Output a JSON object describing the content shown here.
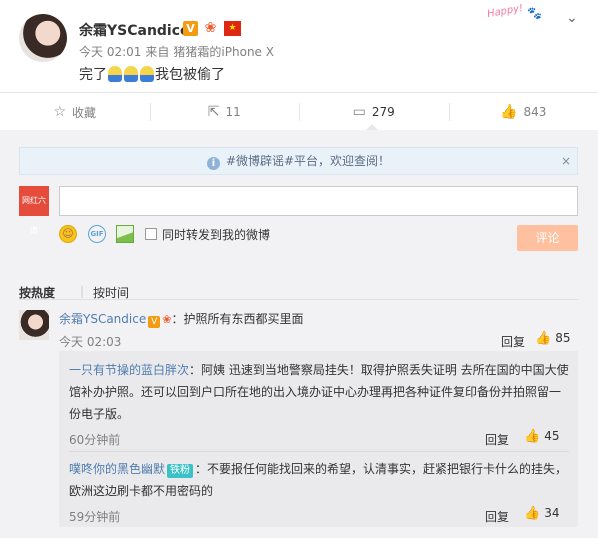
{
  "post": {
    "author": "余霜YSCandice",
    "time": "今天 02:01",
    "source_prefix": "来自",
    "source": "猪猪霜的iPhone X",
    "text_before": "完了",
    "text_after": "我包被偷了",
    "emoji_name": "小黄人表情",
    "stamp_text": "Happy!"
  },
  "actions": {
    "favorite": "收藏",
    "repost_count": "11",
    "comment_count": "279",
    "like_count": "843"
  },
  "comment_box": {
    "notice": "#微博辟谣#平台，欢迎查阅！",
    "notice_close": "×",
    "input_placeholder": "",
    "repost_label": "同时转发到我的微博",
    "submit_label": "评论",
    "my_avatar_text": "网红六道"
  },
  "sort": {
    "hot": "按热度",
    "time": "按时间"
  },
  "top_comment": {
    "name": "余霜YSCandice",
    "text": "：护照所有东西都买里面",
    "time": "今天 02:03",
    "reply_label": "回复",
    "likes": "85"
  },
  "sub_comments": [
    {
      "name": "一只有节操的蓝白胖次",
      "tag": "",
      "text": "：阿姨 迅速到当地警察局挂失！取得护照丢失证明 去所在国的中国大使馆补办护照。还可以回到户口所在地的出入境办证中心办理再把各种证件复印备份并拍照留一份电子版。",
      "time": "60分钟前",
      "reply_label": "回复",
      "likes": "45"
    },
    {
      "name": "噗咚你的黑色幽默",
      "tag": "铁粉",
      "text": "：不要报任何能找回来的希望，认清事实，赶紧把银行卡什么的挂失，欧洲这边刷卡都不用密码的",
      "time": "59分钟前",
      "reply_label": "回复",
      "likes": "34"
    }
  ],
  "colors": {
    "link": "#507daf",
    "submit_disabled": "#ffc09f",
    "verified": "#f39c12"
  }
}
